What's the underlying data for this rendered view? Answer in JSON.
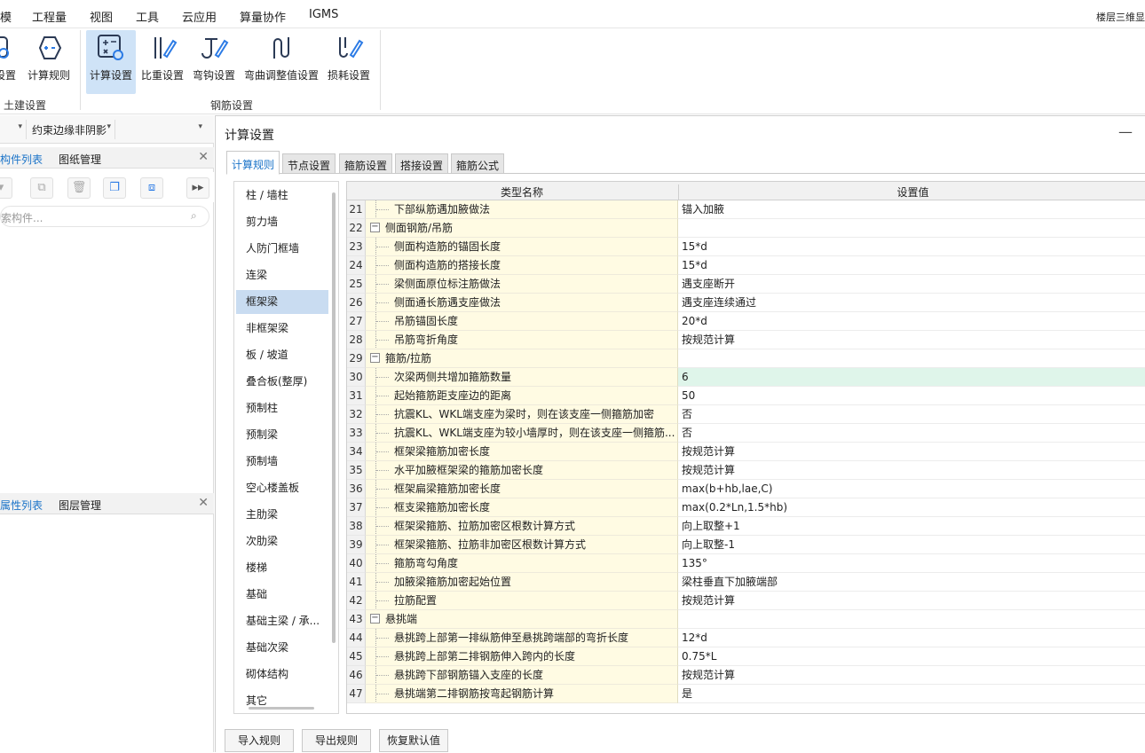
{
  "menu": [
    "模",
    "工程量",
    "视图",
    "工具",
    "云应用",
    "算量协作",
    "IGMS"
  ],
  "menu_right": "楼层三维显",
  "ribbon": {
    "buttons": [
      "设置",
      "计算规则",
      "计算设置",
      "比重设置",
      "弯钩设置",
      "弯曲调整值设置",
      "损耗设置"
    ],
    "groups": [
      "土建设置",
      "钢筋设置"
    ]
  },
  "left": {
    "combo1": "",
    "combo2": "约束边缘非阴影",
    "tabs_top": [
      "构件列表",
      "图纸管理"
    ],
    "search_placeholder": "索构件...",
    "tabs_bottom": [
      "属性列表",
      "图层管理"
    ]
  },
  "dialog": {
    "title": "计算设置",
    "tabs": [
      "计算规则",
      "节点设置",
      "箍筋设置",
      "搭接设置",
      "箍筋公式"
    ],
    "categories": [
      "柱 / 墙柱",
      "剪力墙",
      "人防门框墙",
      "连梁",
      "框架梁",
      "非框架梁",
      "板 / 坡道",
      "叠合板(整厚)",
      "预制柱",
      "预制梁",
      "预制墙",
      "空心楼盖板",
      "主肋梁",
      "次肋梁",
      "楼梯",
      "基础",
      "基础主梁 / 承...",
      "基础次梁",
      "砌体结构",
      "其它"
    ],
    "selected_category": "框架梁",
    "columns": [
      "类型名称",
      "设置值"
    ],
    "rows": [
      {
        "n": "21",
        "name": "下部纵筋遇加腋做法",
        "value": "锚入加腋",
        "group": false
      },
      {
        "n": "22",
        "name": "侧面钢筋/吊筋",
        "value": "",
        "group": true
      },
      {
        "n": "23",
        "name": "侧面构造筋的锚固长度",
        "value": "15*d",
        "group": false
      },
      {
        "n": "24",
        "name": "侧面构造筋的搭接长度",
        "value": "15*d",
        "group": false
      },
      {
        "n": "25",
        "name": "梁侧面原位标注筋做法",
        "value": "遇支座断开",
        "group": false
      },
      {
        "n": "26",
        "name": "侧面通长筋遇支座做法",
        "value": "遇支座连续通过",
        "group": false
      },
      {
        "n": "27",
        "name": "吊筋锚固长度",
        "value": "20*d",
        "group": false
      },
      {
        "n": "28",
        "name": "吊筋弯折角度",
        "value": "按规范计算",
        "group": false
      },
      {
        "n": "29",
        "name": "箍筋/拉筋",
        "value": "",
        "group": true
      },
      {
        "n": "30",
        "name": "次梁两侧共增加箍筋数量",
        "value": "6",
        "group": false,
        "hl": true
      },
      {
        "n": "31",
        "name": "起始箍筋距支座边的距离",
        "value": "50",
        "group": false
      },
      {
        "n": "32",
        "name": "抗震KL、WKL端支座为梁时，则在该支座一侧箍筋加密",
        "value": "否",
        "group": false
      },
      {
        "n": "33",
        "name": "抗震KL、WKL端支座为较小墙厚时，则在该支座一侧箍筋...",
        "value": "否",
        "group": false
      },
      {
        "n": "34",
        "name": "框架梁箍筋加密长度",
        "value": "按规范计算",
        "group": false
      },
      {
        "n": "35",
        "name": "水平加腋框架梁的箍筋加密长度",
        "value": "按规范计算",
        "group": false
      },
      {
        "n": "36",
        "name": "框架扁梁箍筋加密长度",
        "value": "max(b+hb,lae,C)",
        "group": false
      },
      {
        "n": "37",
        "name": "框支梁箍筋加密长度",
        "value": "max(0.2*Ln,1.5*hb)",
        "group": false
      },
      {
        "n": "38",
        "name": "框架梁箍筋、拉筋加密区根数计算方式",
        "value": "向上取整+1",
        "group": false
      },
      {
        "n": "39",
        "name": "框架梁箍筋、拉筋非加密区根数计算方式",
        "value": "向上取整-1",
        "group": false
      },
      {
        "n": "40",
        "name": "箍筋弯勾角度",
        "value": "135°",
        "group": false
      },
      {
        "n": "41",
        "name": "加腋梁箍筋加密起始位置",
        "value": "梁柱垂直下加腋端部",
        "group": false
      },
      {
        "n": "42",
        "name": "拉筋配置",
        "value": "按规范计算",
        "group": false
      },
      {
        "n": "43",
        "name": "悬挑端",
        "value": "",
        "group": true
      },
      {
        "n": "44",
        "name": "悬挑跨上部第一排纵筋伸至悬挑跨端部的弯折长度",
        "value": "12*d",
        "group": false
      },
      {
        "n": "45",
        "name": "悬挑跨上部第二排钢筋伸入跨内的长度",
        "value": "0.75*L",
        "group": false
      },
      {
        "n": "46",
        "name": "悬挑跨下部钢筋锚入支座的长度",
        "value": "按规范计算",
        "group": false
      },
      {
        "n": "47",
        "name": "悬挑端第二排钢筋按弯起钢筋计算",
        "value": "是",
        "group": false
      }
    ],
    "footer_buttons": [
      "导入规则",
      "导出规则",
      "恢复默认值"
    ]
  },
  "colors": {
    "accent": "#1a73c8",
    "selected": "#c9dcf1",
    "name_bg": "#fffbe3",
    "highlight": "#dff5ea"
  }
}
